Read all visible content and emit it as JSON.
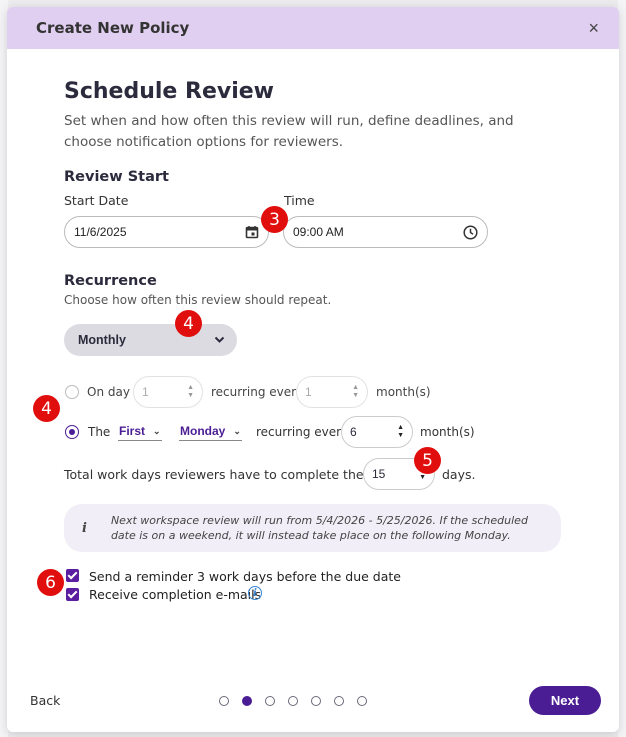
{
  "modal": {
    "title": "Create New Policy",
    "close_label": "×"
  },
  "page": {
    "heading": "Schedule Review",
    "description": "Set when and how often this review will run, define deadlines, and choose notification options for reviewers."
  },
  "review_start": {
    "title": "Review Start",
    "start_date_label": "Start Date",
    "start_date_value": "11/6/2025",
    "time_label": "Time",
    "time_value": "09:00 AM"
  },
  "recurrence": {
    "title": "Recurrence",
    "subtitle": "Choose how often this review should repeat.",
    "frequency_value": "Monthly",
    "option_day": {
      "label": "On day",
      "day_value": "1",
      "middle_text": "recurring every",
      "every_value": "1",
      "unit": "month(s)",
      "selected": false
    },
    "option_the": {
      "label": "The",
      "ordinal_value": "First",
      "weekday_value": "Monday",
      "middle_text": "recurring every",
      "every_value": "6",
      "unit": "month(s)",
      "selected": true
    }
  },
  "workdays": {
    "label": "Total work days reviewers have to complete the task:",
    "value": "15",
    "unit": "days."
  },
  "info": {
    "icon": "i",
    "text": "Next workspace review will run from 5/4/2026 - 5/25/2026. If the scheduled date is on a weekend, it will instead take place on the following Monday."
  },
  "notifications": {
    "reminder_label": "Send a reminder 3 work days before the due date",
    "reminder_checked": true,
    "completion_label": "Receive completion e-mails",
    "completion_checked": true
  },
  "footer": {
    "back_label": "Back",
    "next_label": "Next",
    "steps_total": 7,
    "current_step": 2
  },
  "annotations": [
    "3",
    "4",
    "4",
    "5",
    "6"
  ],
  "colors": {
    "primary": "#4b1d95",
    "header_bg": "#e0cff0",
    "badge": "#e10e0e",
    "info_bg": "#f1eef7"
  }
}
